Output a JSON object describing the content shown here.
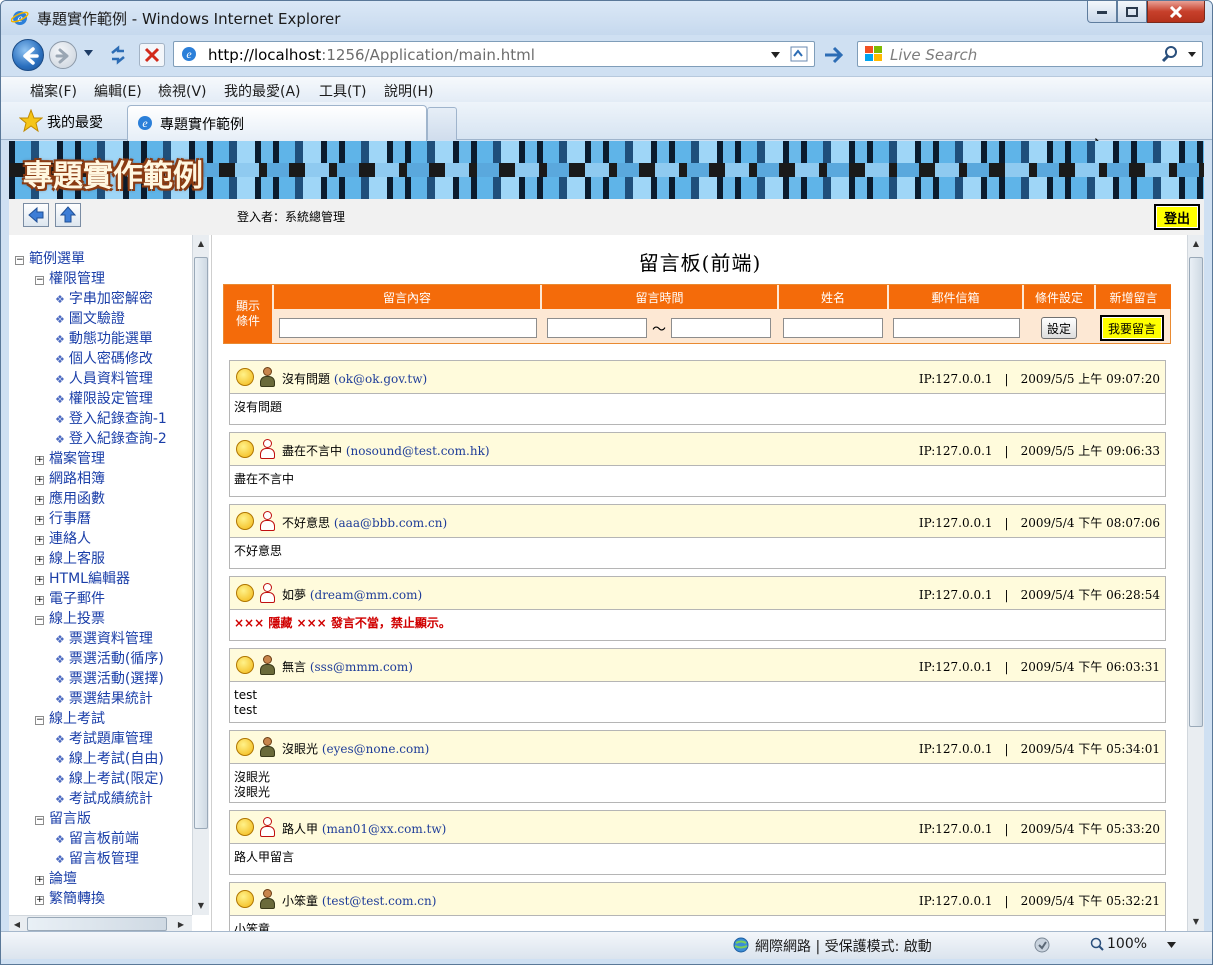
{
  "window": {
    "title": "專題實作範例 - Windows Internet Explorer"
  },
  "address": {
    "url_host": "http://localhost",
    "url_rest": ":1256/Application/main.html"
  },
  "search": {
    "placeholder": "Live Search"
  },
  "menu": [
    "檔案(F)",
    "編輯(E)",
    "檢視(V)",
    "我的最愛(A)",
    "工具(T)",
    "說明(H)"
  ],
  "favorites": {
    "label": "我的最愛"
  },
  "tab": {
    "label": "專題實作範例"
  },
  "banner": {
    "title": "專題實作範例"
  },
  "user": {
    "login_text": "登入者：系統總管理",
    "logout": "登出"
  },
  "tree": [
    {
      "label": "範例選單",
      "level": 0,
      "expanded": true
    },
    {
      "label": "權限管理",
      "level": 1,
      "expanded": true
    },
    {
      "label": "字串加密解密",
      "level": 2
    },
    {
      "label": "圖文驗證",
      "level": 2
    },
    {
      "label": "動態功能選單",
      "level": 2
    },
    {
      "label": "個人密碼修改",
      "level": 2
    },
    {
      "label": "人員資料管理",
      "level": 2
    },
    {
      "label": "權限設定管理",
      "level": 2
    },
    {
      "label": "登入紀錄查詢-1",
      "level": 2
    },
    {
      "label": "登入紀錄查詢-2",
      "level": 2
    },
    {
      "label": "檔案管理",
      "level": 1,
      "expanded": false
    },
    {
      "label": "網路相簿",
      "level": 1,
      "expanded": false
    },
    {
      "label": "應用函數",
      "level": 1,
      "expanded": false
    },
    {
      "label": "行事曆",
      "level": 1,
      "expanded": false
    },
    {
      "label": "連絡人",
      "level": 1,
      "expanded": false
    },
    {
      "label": "線上客服",
      "level": 1,
      "expanded": false
    },
    {
      "label": "HTML編輯器",
      "level": 1,
      "expanded": false
    },
    {
      "label": "電子郵件",
      "level": 1,
      "expanded": false
    },
    {
      "label": "線上投票",
      "level": 1,
      "expanded": true
    },
    {
      "label": "票選資料管理",
      "level": 2
    },
    {
      "label": "票選活動(循序)",
      "level": 2
    },
    {
      "label": "票選活動(選擇)",
      "level": 2
    },
    {
      "label": "票選結果統計",
      "level": 2
    },
    {
      "label": "線上考試",
      "level": 1,
      "expanded": true
    },
    {
      "label": "考試題庫管理",
      "level": 2
    },
    {
      "label": "線上考試(自由)",
      "level": 2
    },
    {
      "label": "線上考試(限定)",
      "level": 2
    },
    {
      "label": "考試成績統計",
      "level": 2
    },
    {
      "label": "留言版",
      "level": 1,
      "expanded": true
    },
    {
      "label": "留言板前端",
      "level": 2
    },
    {
      "label": "留言板管理",
      "level": 2
    },
    {
      "label": "論壇",
      "level": 1,
      "expanded": false
    },
    {
      "label": "繁簡轉換",
      "level": 1,
      "expanded": false
    }
  ],
  "board": {
    "title": "留言板(前端)",
    "filter_label": "顯示條件",
    "col_content": "留言內容",
    "col_time": "留言時間",
    "time_sep": "～",
    "col_name": "姓名",
    "col_email": "郵件信箱",
    "col_setting": "條件設定",
    "set_button": "設定",
    "col_new": "新增留言",
    "new_button": "我要留言"
  },
  "messages": [
    {
      "mood": "hand-icon",
      "gender": "m",
      "name": "沒有問題",
      "email": "ok@ok.gov.tw",
      "ip": "IP:127.0.0.1",
      "time": "2009/5/5 上午 09:07:20",
      "lines": [
        "沒有問題"
      ],
      "hidden": false
    },
    {
      "mood": "smirk-icon",
      "gender": "f",
      "name": "盡在不言中",
      "email": "nosound@test.com.hk",
      "ip": "IP:127.0.0.1",
      "time": "2009/5/5 上午 09:06:33",
      "lines": [
        "盡在不言中"
      ],
      "hidden": false
    },
    {
      "mood": "kiss-icon",
      "gender": "f",
      "name": "不好意思",
      "email": "aaa@bbb.com.cn",
      "ip": "IP:127.0.0.1",
      "time": "2009/5/4 下午 08:07:06",
      "lines": [
        "不好意思"
      ],
      "hidden": false
    },
    {
      "mood": "bell-icon",
      "gender": "f",
      "name": "如夢",
      "email": "dream@mm.com",
      "ip": "IP:127.0.0.1",
      "time": "2009/5/4 下午 06:28:54",
      "lines": [
        "××× 隱藏 ××× 發言不當，禁止顯示。"
      ],
      "hidden": true
    },
    {
      "mood": "smirk-icon",
      "gender": "m",
      "name": "無言",
      "email": "sss@mmm.com",
      "ip": "IP:127.0.0.1",
      "time": "2009/5/4 下午 06:03:31",
      "lines": [
        "test",
        "test"
      ],
      "hidden": false
    },
    {
      "mood": "sunglasses-icon",
      "gender": "m",
      "name": "沒眼光",
      "email": "eyes@none.com",
      "ip": "IP:127.0.0.1",
      "time": "2009/5/4 下午 05:34:01",
      "lines": [
        "沒眼光",
        "沒眼光"
      ],
      "hidden": false
    },
    {
      "mood": "broken-heart-icon",
      "gender": "f",
      "name": "路人甲",
      "email": "man01@xx.com.tw",
      "ip": "IP:127.0.0.1",
      "time": "2009/5/4 下午 05:33:20",
      "lines": [
        "路人甲留言"
      ],
      "hidden": false
    },
    {
      "mood": "pig-icon",
      "gender": "m",
      "name": "小笨童",
      "email": "test@test.com.cn",
      "ip": "IP:127.0.0.1",
      "time": "2009/5/4 下午 05:32:21",
      "lines": [
        "小笨童"
      ],
      "hidden": false
    }
  ],
  "status": {
    "zone": "網際網路 | 受保護模式: 啟動",
    "zoom": "100%"
  }
}
